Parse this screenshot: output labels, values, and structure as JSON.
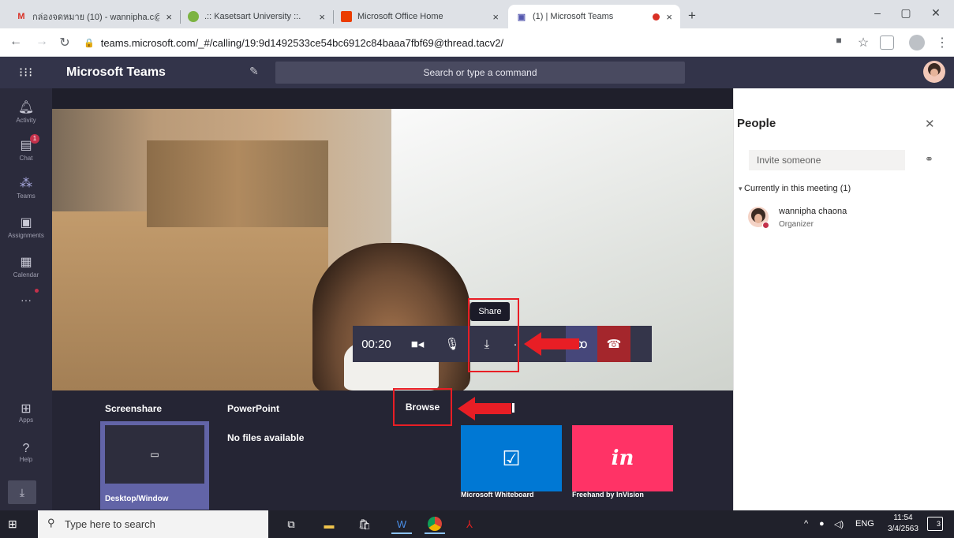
{
  "browser": {
    "tabs": [
      {
        "title": "กล่องจดหมาย (10) - wannipha.c@k",
        "icon": "gmail-icon",
        "active": false
      },
      {
        "title": ".:: Kasetsart University ::.",
        "icon": "globe-icon",
        "active": false
      },
      {
        "title": "Microsoft Office Home",
        "icon": "office-icon",
        "active": false
      },
      {
        "title": "(1) | Microsoft Teams",
        "icon": "teams-icon",
        "active": true
      }
    ],
    "close_glyph": "×",
    "new_tab": "+",
    "url": "teams.microsoft.com/_#/calling/19:9d1492533ce54bc6912c84baaa7fbf69@thread.tacv2/",
    "window_controls": [
      "–",
      "▢",
      "✕"
    ]
  },
  "teams": {
    "title": "Microsoft Teams",
    "search_placeholder": "Search or type a command",
    "rail": [
      {
        "label": "Activity",
        "icon": "bell-icon"
      },
      {
        "label": "Chat",
        "icon": "chat-icon",
        "badge": "1"
      },
      {
        "label": "Teams",
        "icon": "teams-icon"
      },
      {
        "label": "Assignments",
        "icon": "assignments-icon"
      },
      {
        "label": "Calendar",
        "icon": "calendar-icon"
      }
    ],
    "rail_more": "···",
    "rail_bottom": [
      {
        "label": "Apps",
        "icon": "apps-icon"
      },
      {
        "label": "Help",
        "icon": "help-icon"
      }
    ]
  },
  "call": {
    "timer": "00:20",
    "tooltip": "Share"
  },
  "share_tray": {
    "screenshare_header": "Screenshare",
    "powerpoint_header": "PowerPoint",
    "no_files": "No files available",
    "browse": "Browse",
    "desktop_label": "Desktop/Window",
    "whiteboard_label": "Microsoft Whiteboard",
    "freehand_label": "Freehand by InVision",
    "freehand_logo": "in",
    "whiteboard_color": "#0078d4",
    "freehand_color": "#ff3366"
  },
  "people": {
    "title": "People",
    "invite_placeholder": "Invite someone",
    "section": "Currently in this meeting (1)",
    "person_name": "wannipha chaona",
    "person_role": "Organizer"
  },
  "taskbar": {
    "search_placeholder": "Type here to search",
    "language": "ENG",
    "time": "11:54",
    "date": "3/4/2563",
    "notifications": "3"
  }
}
